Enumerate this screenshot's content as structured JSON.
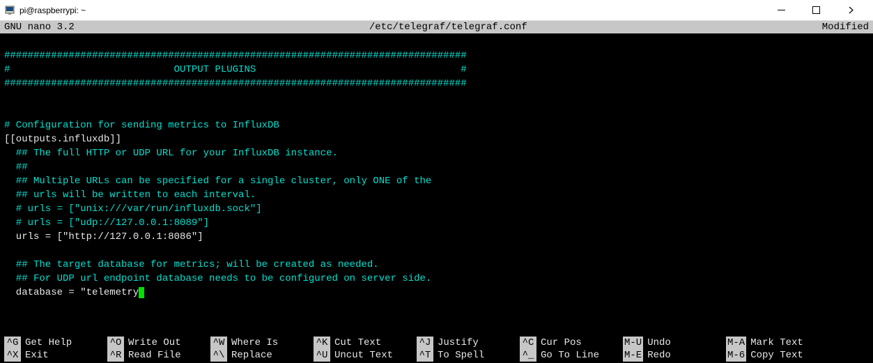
{
  "window": {
    "title": "pi@raspberrypi: ~"
  },
  "nano": {
    "app": "GNU nano 3.2",
    "file": "/etc/telegraf/telegraf.conf",
    "status": "Modified"
  },
  "lines": [
    {
      "cls": "cyan",
      "t": "###############################################################################"
    },
    {
      "cls": "cyan",
      "t": "#                            OUTPUT PLUGINS                                   #"
    },
    {
      "cls": "cyan",
      "t": "###############################################################################"
    },
    {
      "cls": "",
      "t": ""
    },
    {
      "cls": "",
      "t": ""
    },
    {
      "cls": "cyan",
      "t": "# Configuration for sending metrics to InfluxDB"
    },
    {
      "cls": "white",
      "t": "[[outputs.influxdb]]"
    },
    {
      "cls": "cyan",
      "t": "  ## The full HTTP or UDP URL for your InfluxDB instance."
    },
    {
      "cls": "cyan",
      "t": "  ##"
    },
    {
      "cls": "cyan",
      "t": "  ## Multiple URLs can be specified for a single cluster, only ONE of the"
    },
    {
      "cls": "cyan",
      "t": "  ## urls will be written to each interval."
    },
    {
      "cls": "cyan",
      "t": "  # urls = [\"unix:///var/run/influxdb.sock\"]"
    },
    {
      "cls": "cyan",
      "t": "  # urls = [\"udp://127.0.0.1:8089\"]"
    },
    {
      "cls": "white",
      "t": "  urls = [\"http://127.0.0.1:8086\"]"
    },
    {
      "cls": "",
      "t": ""
    },
    {
      "cls": "cyan",
      "t": "  ## The target database for metrics; will be created as needed."
    },
    {
      "cls": "cyan",
      "t": "  ## For UDP url endpoint database needs to be configured on server side."
    }
  ],
  "cursor_line": {
    "prefix": "  database = \"telemetry",
    "suffix": "\""
  },
  "shortcuts": {
    "row1": [
      {
        "k": "^G",
        "l": "Get Help"
      },
      {
        "k": "^O",
        "l": "Write Out"
      },
      {
        "k": "^W",
        "l": "Where Is"
      },
      {
        "k": "^K",
        "l": "Cut Text"
      },
      {
        "k": "^J",
        "l": "Justify"
      },
      {
        "k": "^C",
        "l": "Cur Pos"
      },
      {
        "k": "M-U",
        "l": "Undo"
      },
      {
        "k": "M-A",
        "l": "Mark Text"
      }
    ],
    "row2": [
      {
        "k": "^X",
        "l": "Exit"
      },
      {
        "k": "^R",
        "l": "Read File"
      },
      {
        "k": "^\\",
        "l": "Replace"
      },
      {
        "k": "^U",
        "l": "Uncut Text"
      },
      {
        "k": "^T",
        "l": "To Spell"
      },
      {
        "k": "^_",
        "l": "Go To Line"
      },
      {
        "k": "M-E",
        "l": "Redo"
      },
      {
        "k": "M-6",
        "l": "Copy Text"
      }
    ]
  }
}
